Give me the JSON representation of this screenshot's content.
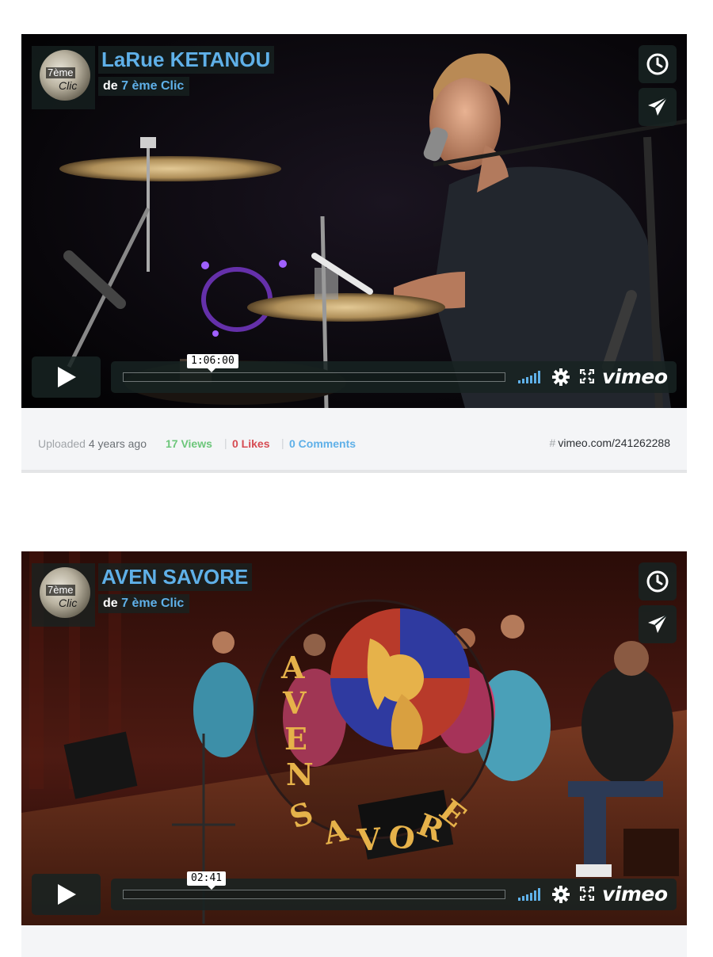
{
  "videos": [
    {
      "title": "LaRue KETANOU",
      "by_prefix": "de",
      "author": "7 ème Clic",
      "portrait_label": "7ème",
      "portrait_label2": "Clic",
      "timecode": "1:06:00",
      "brand": "vimeo",
      "meta": {
        "uploaded_prefix": "Uploaded",
        "uploaded_ago": "4 years ago",
        "views": "17 Views",
        "likes": "0 Likes",
        "comments": "0 Comments",
        "hash": "#",
        "link": "vimeo.com/241262288"
      }
    },
    {
      "title": "AVEN SAVORE",
      "by_prefix": "de",
      "author": "7 ème Clic",
      "portrait_label": "7ème",
      "portrait_label2": "Clic",
      "timecode": "02:41",
      "brand": "vimeo",
      "poster_text_vertical": "AVEN",
      "poster_text_arc": "SAVORE"
    }
  ],
  "icons": {
    "watch_later": "clock-icon",
    "share": "paper-plane-icon",
    "play": "play-icon",
    "volume": "volume-bars-icon",
    "settings": "gear-icon",
    "fullscreen": "fullscreen-icon"
  },
  "colors": {
    "accent": "#5fb0e8",
    "views": "#6cc67a",
    "likes": "#d64b52",
    "panel": "#172322"
  }
}
